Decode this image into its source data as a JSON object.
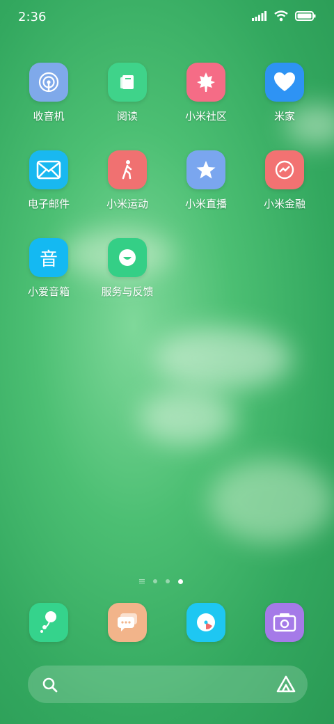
{
  "status": {
    "time": "2:36"
  },
  "apps": [
    {
      "label": "收音机",
      "color": "#7fa9ea",
      "icon": "radio-icon"
    },
    {
      "label": "阅读",
      "color": "#3fd38a",
      "icon": "book-icon"
    },
    {
      "label": "小米社区",
      "color": "#f56c86",
      "icon": "maple-leaf-icon"
    },
    {
      "label": "米家",
      "color": "#2e93f4",
      "icon": "heart-icon"
    },
    {
      "label": "电子邮件",
      "color": "#19b8f0",
      "icon": "mail-icon"
    },
    {
      "label": "小米运动",
      "color": "#f07171",
      "icon": "walking-icon"
    },
    {
      "label": "小米直播",
      "color": "#7aa6ef",
      "icon": "star-icon"
    },
    {
      "label": "小米金融",
      "color": "#f27272",
      "icon": "finance-icon"
    },
    {
      "label": "小爱音箱",
      "color": "#14b9f2",
      "icon": "speaker-glyph-icon",
      "glyph": "音"
    },
    {
      "label": "服务与反馈",
      "color": "#34cf86",
      "icon": "smile-icon"
    }
  ],
  "dock": [
    {
      "name": "dock-app-1",
      "color": "#35d38c",
      "icon": "balloon-icon"
    },
    {
      "name": "dock-app-2",
      "color": "#f2b48a",
      "icon": "chat-icon"
    },
    {
      "name": "dock-app-3",
      "color": "#1ec7f2",
      "icon": "browser-icon"
    },
    {
      "name": "dock-app-4",
      "color": "#a57ae8",
      "icon": "camera-icon"
    }
  ],
  "page_indicator": {
    "current": 4,
    "total": 4
  }
}
